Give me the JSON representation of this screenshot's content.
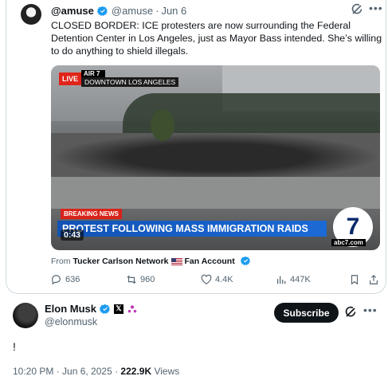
{
  "quoted": {
    "display_name": "@amuse",
    "handle": "@amuse",
    "separator": "·",
    "date": "Jun 6",
    "text": "CLOSED BORDER: ICE protesters are now surrounding the Federal Detention Center in Los Angeles, just as Mayor Bass intended. She’s willing to do anything to shield illegals.",
    "media": {
      "live_label": "LIVE",
      "air_label": "AIR 7",
      "location_label": "DOWNTOWN LOS ANGELES",
      "breaking_label": "BREAKING NEWS",
      "headline": "PROTEST FOLLOWING MASS IMMIGRATION RAIDS",
      "network_logo_text": "7",
      "network_site": "abc7.com",
      "duration": "0:43"
    },
    "from_label": "From",
    "from_source": "Tucker Carlson Network",
    "from_suffix": "Fan Account",
    "stats": {
      "replies": "636",
      "reposts": "960",
      "likes": "4.4K",
      "views": "447K"
    }
  },
  "author": {
    "display_name": "Elon Musk",
    "handle": "@elonmusk",
    "subscribe_label": "Subscribe"
  },
  "tweet": {
    "text": "!",
    "timestamp": "10:20 PM · Jun 6, 2025 · ",
    "views_count": "222.9K",
    "views_label": " Views"
  },
  "colors": {
    "verified": "#1d9bf0",
    "muted": "#536471",
    "text": "#0f1419"
  }
}
